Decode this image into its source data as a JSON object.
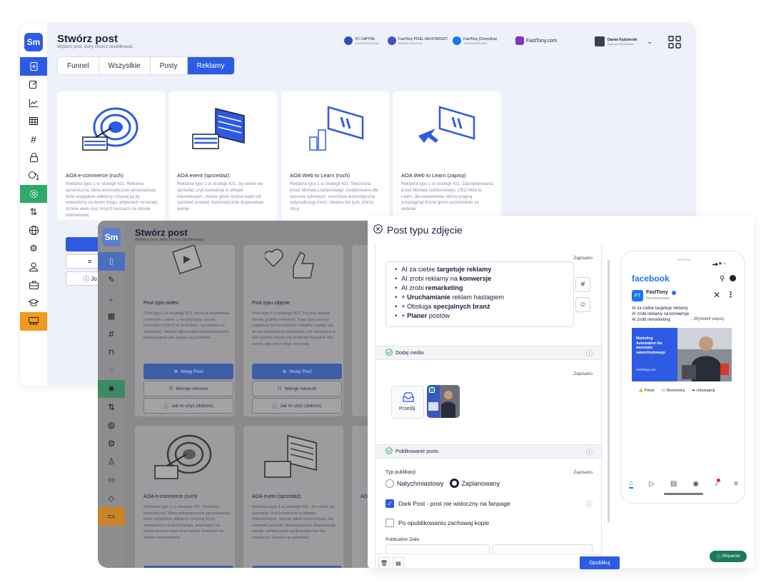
{
  "colors": {
    "accent": "#2d5be3",
    "green": "#2fa96a",
    "orange": "#f39a1c",
    "fb_blue": "#1877f2",
    "support": "#1a7a5a"
  },
  "back": {
    "logo": "Sm",
    "title": "Stwórz post",
    "subtitle": "Wybierz post, który chcesz opublikować.",
    "tabs": [
      "Funnel",
      "Wszystkie",
      "Posty",
      "Reklamy"
    ],
    "active_tab": "Reklamy",
    "accounts": [
      {
        "name": "VC CAPITAL",
        "id": "103204932224145",
        "icon": "messenger-icon"
      },
      {
        "name": "FastTony PIXEL NAJSTARSZY",
        "id": "888254714404722",
        "icon": "pixel-icon"
      },
      {
        "name": "FastTony (Domyślna)",
        "id": "164604592052693",
        "icon": "facebook-icon"
      },
      {
        "name": "FastTony.com",
        "id": "",
        "icon": "linkedin-icon"
      }
    ],
    "user": {
      "name": "Daniel Kędzierski",
      "role": "Agencja Reklamowa"
    },
    "cards": [
      {
        "title": "AOA e-commerce (ruch)",
        "desc": "Reklama typu 1 w strategii 421. Reklama dynamiczna, która automatycznie personalizuje treść względem odbiorcy. Używaj jej by odwiedziny na twoim blogu, artykułach na twojej stronie www oraz innych treściach na stronie internetowej."
      },
      {
        "title": "AOA event (sprzedaż)",
        "desc": "Reklama typu 1 w strategii 421. Jej celem się sprzedaż czyli konwersja w sklepie internetowym, stronie gdzie można kupić lub zamówić produkt. Automatycznie dopasowuje wersje"
      },
      {
        "title": "AOA Web to Learn (ruch)",
        "desc": "Reklama typu 1 w strategii 421. Stworzona przez Michała Lidzborskiego. Dedykowana dla twórców cyfrowych, umożliwia automatyczną optymalizację treści. Idealna dla tych, którzy chcą"
      },
      {
        "title": "AOA Web to Learn (zapisy)",
        "desc": "Reklama typu 1 w strategii 421. Zaprojektowana przez Michała Lidzborskiego, CEO Web to Learn, dla marketerów, którzy pragną przyciągnąć liczne grono uczestników na webinar"
      }
    ],
    "buttons": {
      "new_post": "Nowy Post",
      "drafts": "Wersje robocze",
      "how_to": "Jak to użyć (dobrze)"
    }
  },
  "front": {
    "logo": "Sm",
    "title": "Stwórz post",
    "subtitle": "Wybierz post, który chcesz opublikować.",
    "cards_top": [
      {
        "title": "Post typu wideo",
        "desc": "Post typu 2 w strategii 421. Kreacja reklamowa z tekstem i video, z możliwością użycia przycisku CTA (Call To Action - wezwanie do działania). Idealne dla postów instruktażowych, pokazywania jak używa się produktu."
      },
      {
        "title": "Post typu zdjęcie",
        "desc": "Post typu 4 w strategii 421. Przykuj uwagę klienta grafiką i tekstem. Tego typu post to najlepsza forma reklamy. Idealnie nadaje się do prezentowania produktów, ich otoczenia w jaki sposób używa się produktu lub jakie ma zalety, gdy się z niego korzysta."
      }
    ],
    "cards_bottom": [
      {
        "title": "AOA e-commerce (ruch)",
        "desc": "Reklama typu 1 w strategii 421. Reklama dynamiczna, która automatycznie personalizuje treść względem odbiorcy. Używaj jej by odwiedziny na twoim blogu, artykułach na twojej stronie www oraz innych treściach na stronie internetowej."
      },
      {
        "title": "AOA event (sprzedaż)",
        "desc": "Reklama typu 1 w strategii 421. Jej celem się sprzedaż czyli konwersja w sklepie internetowym, stronie gdzie można kupić lub zamówić produkt. Automatycznie dopasowuje wersje reklamy pod użytkownika tak aby zwiększyć szanse na sprzedaż."
      }
    ],
    "partial_title": "AO",
    "buttons": {
      "new_post": "Nowy Post",
      "drafts": "Wersje robocze",
      "how_to": "Jak to użyć (dobrze)"
    }
  },
  "modal": {
    "title": "Post typu zdjęcie",
    "saved": "Zapisano",
    "text_lines": [
      {
        "pre": "AI za ciebie ",
        "bold": "targetuje reklamy",
        "post": ""
      },
      {
        "pre": "AI zrobi reklamy na ",
        "bold": "konwersje",
        "post": ""
      },
      {
        "pre": "AI zrobi ",
        "bold": "remarketing",
        "post": ""
      },
      {
        "pre": "+ ",
        "bold": "Uruchamianie",
        "post": " reklam hastagiem"
      },
      {
        "pre": "+ Obsługa ",
        "bold": "specjalnych branż",
        "post": ""
      },
      {
        "pre": "+ ",
        "bold": "Planer",
        "post": " postów"
      }
    ],
    "hash_btn": "#",
    "add_media": "Dodaj media",
    "upload_label": "Prześlij",
    "publishing": "Publikowanie postu",
    "publication_type_label": "Typ publikacji",
    "option_now": "Natychmiastowy",
    "option_scheduled": "Zaplanowany",
    "dark_post": "Dark Post - post nie widoczny na fanpage",
    "keep_copy": "Po opublikowaniu zachowaj kopie",
    "publication_date": "Publication Date",
    "publish_btn": "Opublikuj"
  },
  "preview": {
    "brand": "facebook",
    "page": "FastTony",
    "sponsored": "Sponsorowane",
    "lines": [
      "AI za ciebie targetuje reklamy",
      "AI zrobi reklamy na konwersje",
      "AI zrobi remarketing"
    ],
    "see_more": "...Wyświetl więcej",
    "ad_text": "Marketing Automation dla warsztatu samochodowego",
    "ad_url": "FastTony.com",
    "actions": [
      "Polub",
      "Skomentuj",
      "Udostępnij"
    ]
  },
  "support": "Wsparcie"
}
